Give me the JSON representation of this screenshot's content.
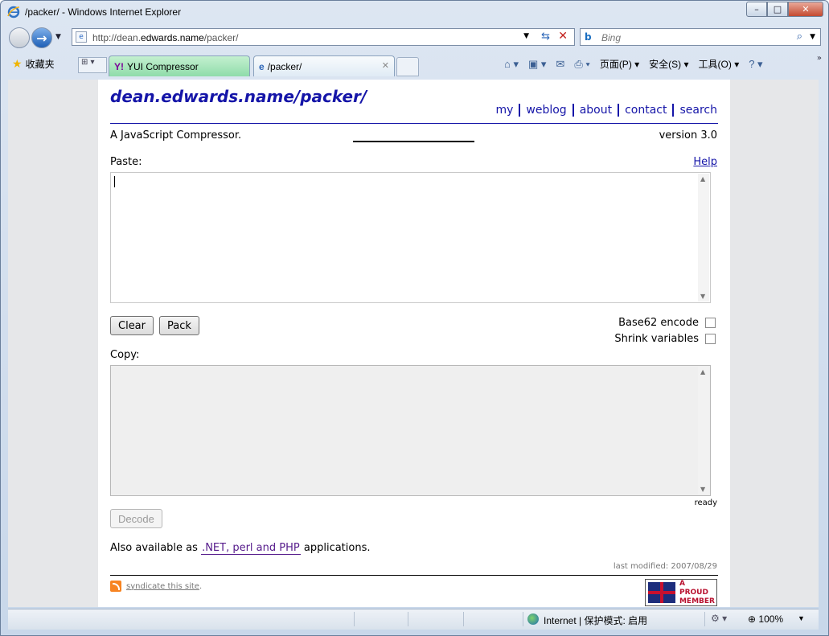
{
  "window": {
    "title": "/packer/ - Windows Internet Explorer",
    "min_label": "–",
    "max_label": "□",
    "close_label": "✕"
  },
  "nav": {
    "url_prefix": "http://dean.",
    "url_host": "edwards.name",
    "url_suffix": "/packer/",
    "search_placeholder": "Bing"
  },
  "favorites": {
    "label": "收藏夹"
  },
  "tabs": [
    {
      "label": "YUI Compressor",
      "icon": "yahoo-icon",
      "active": false
    },
    {
      "label": "/packer/",
      "icon": "ie-page-icon",
      "active": true
    }
  ],
  "commandbar": {
    "page_label": "页面(P)",
    "safety_label": "安全(S)",
    "tools_label": "工具(O)"
  },
  "site": {
    "title": "dean.edwards.name/packer/",
    "nav": [
      "my",
      "weblog",
      "about",
      "contact",
      "search"
    ],
    "subtitle": "A JavaScript Compressor.",
    "version": "version 3.0"
  },
  "form": {
    "paste_label": "Paste:",
    "help_label": "Help",
    "paste_value": "",
    "clear_label": "Clear",
    "pack_label": "Pack",
    "base62_label": "Base62 encode",
    "base62_checked": false,
    "shrink_label": "Shrink variables",
    "shrink_checked": false,
    "copy_label": "Copy:",
    "copy_value": "",
    "status": "ready",
    "decode_label": "Decode"
  },
  "footer": {
    "avail_prefix": "Also available as",
    "avail_link": ".NET, perl and PHP",
    "avail_suffix": "applications.",
    "last_modified": "last modified: 2007/08/29",
    "syndicate_link": "syndicate this site",
    "syndicate_suffix": ".",
    "badge_line1": "A PROUD",
    "badge_line2": "MEMBER"
  },
  "statusbar": {
    "zone": "Internet | 保护模式: 启用",
    "zoom": "100%"
  },
  "colors": {
    "link_blue": "#1515a8",
    "visited_purple": "#551a8b"
  }
}
